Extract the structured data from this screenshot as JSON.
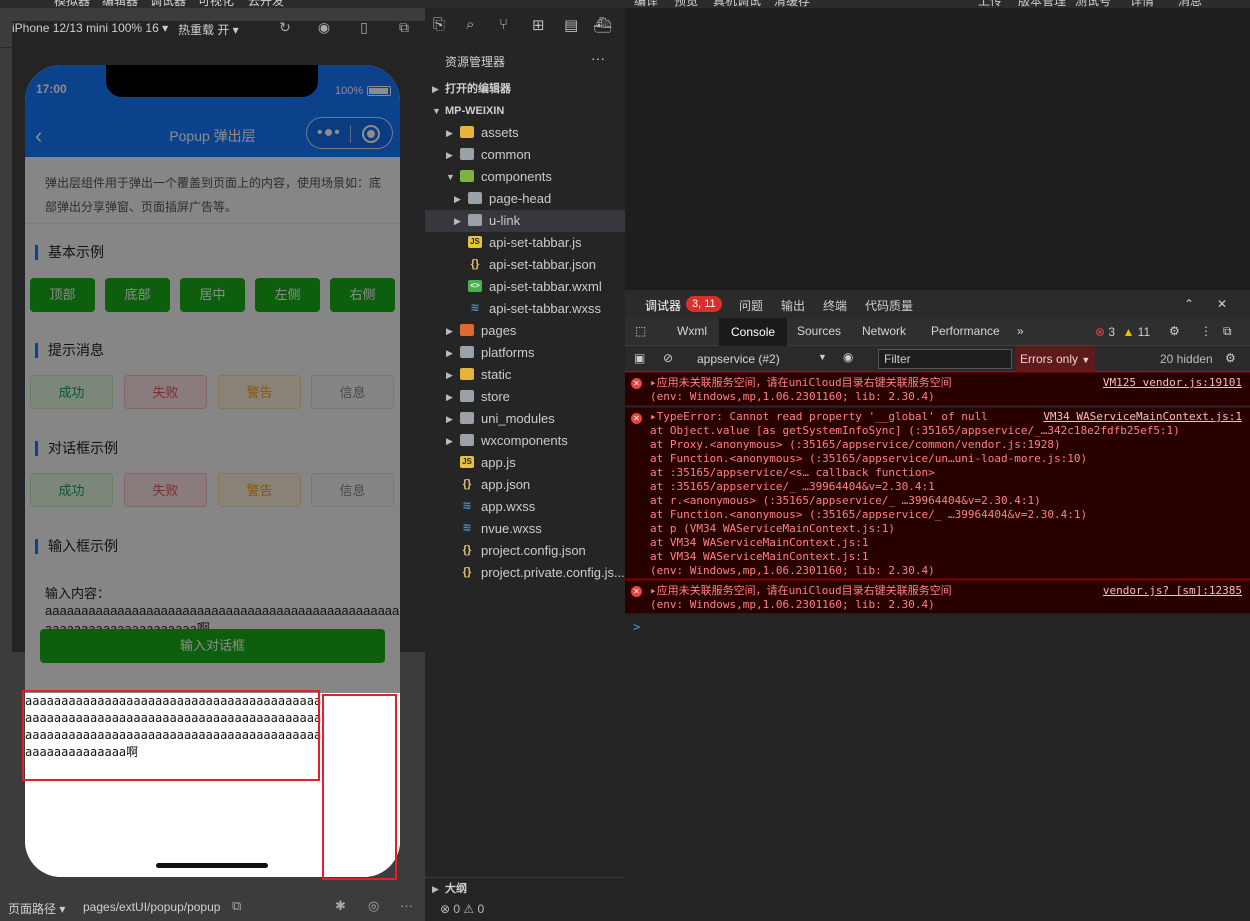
{
  "simulator": {
    "device": "iPhone 12/13 mini 100% 16 ▾",
    "hot_reload": "热重载 开 ▾",
    "status_time": "17:00",
    "battery": "100%",
    "nav_title": "Popup 弹出层",
    "intro": "弹出层组件用于弹出一个覆盖到页面上的内容，使用场景如：底部弹出分享弹窗、页面插屏广告等。",
    "sections": {
      "basic": "基本示例",
      "message": "提示消息",
      "dialog": "对话框示例",
      "input": "输入框示例"
    },
    "basic_buttons": [
      "顶部",
      "底部",
      "居中",
      "左侧",
      "右侧"
    ],
    "message_buttons": [
      "成功",
      "失败",
      "警告",
      "信息"
    ],
    "dialog_buttons": [
      "成功",
      "失败",
      "警告",
      "信息"
    ],
    "input_label": "输入内容：",
    "input_value": "aaaaaaaaaaaaaaaaaaaaaaaaaaaaaaaaaaaaaaaaaaaaaaaaaaaaaaaaaaaaaaaaaaaaaa啊",
    "input_button": "输入对话框",
    "popup_text": "aaaaaaaaaaaaaaaaaaaaaaaaaaaaaaaaaaaaaaaaaaaaaaaaaaaaaaaaaaaaaaaaaaaaaaaaaaaaaaaaaaaaaaaaaaaaaaaaaaaaaaaaaaaaaaaaaaaaaaaaaaaaaaaaaaaaaaaaa啊",
    "bottom_path_label": "页面路径 ▾",
    "bottom_path": "pages/extUI/popup/popup"
  },
  "top_menu": [
    "模拟器",
    "编辑器",
    "调试器",
    "可视化",
    "云开发",
    "编译",
    "预览",
    "真机调试",
    "清缓存",
    "上传",
    "版本管理",
    "测试号",
    "详情",
    "消息"
  ],
  "explorer": {
    "title": "资源管理器",
    "more": "···",
    "open_editors": "打开的编辑器",
    "project": "MP-WEIXIN",
    "items": [
      {
        "label": "assets",
        "type": "folder-y",
        "depth": 1
      },
      {
        "label": "common",
        "type": "folder",
        "depth": 1
      },
      {
        "label": "components",
        "type": "folder-g",
        "depth": 1,
        "open": true
      },
      {
        "label": "page-head",
        "type": "folder",
        "depth": 2
      },
      {
        "label": "u-link",
        "type": "folder",
        "depth": 2,
        "selected": true
      },
      {
        "label": "api-set-tabbar.js",
        "type": "js",
        "depth": 2
      },
      {
        "label": "api-set-tabbar.json",
        "type": "json",
        "depth": 2
      },
      {
        "label": "api-set-tabbar.wxml",
        "type": "wxml",
        "depth": 2
      },
      {
        "label": "api-set-tabbar.wxss",
        "type": "wxss",
        "depth": 2
      },
      {
        "label": "pages",
        "type": "folder-o",
        "depth": 1
      },
      {
        "label": "platforms",
        "type": "folder",
        "depth": 1
      },
      {
        "label": "static",
        "type": "folder-y",
        "depth": 1
      },
      {
        "label": "store",
        "type": "folder",
        "depth": 1
      },
      {
        "label": "uni_modules",
        "type": "folder",
        "depth": 1
      },
      {
        "label": "wxcomponents",
        "type": "folder",
        "depth": 1
      },
      {
        "label": "app.js",
        "type": "js",
        "depth": 1
      },
      {
        "label": "app.json",
        "type": "json",
        "depth": 1
      },
      {
        "label": "app.wxss",
        "type": "wxss",
        "depth": 1
      },
      {
        "label": "nvue.wxss",
        "type": "wxss",
        "depth": 1
      },
      {
        "label": "project.config.json",
        "type": "json",
        "depth": 1
      },
      {
        "label": "project.private.config.js...",
        "type": "json",
        "depth": 1
      }
    ],
    "outline": "大纲",
    "status": "⊗ 0 ⚠ 0"
  },
  "devtools": {
    "tabs_top": [
      "调试器",
      "问题",
      "输出",
      "终端",
      "代码质量"
    ],
    "badge": "3, 11",
    "panel_tabs": [
      "Wxml",
      "Console",
      "Sources",
      "Network",
      "Performance"
    ],
    "active_tab": "Console",
    "error_count": "3",
    "warn_count": "11",
    "context": "appservice (#2)",
    "filter_placeholder": "Filter",
    "level": "Errors only",
    "hidden": "20 hidden",
    "entries": [
      {
        "lines": [
          "▸应用未关联服务空间，请在uniCloud目录右键关联服务空间",
          "(env: Windows,mp,1.06.2301160; lib: 2.30.4)"
        ],
        "source": "VM125 vendor.js:19101"
      },
      {
        "lines": [
          "▸TypeError: Cannot read property '__global' of null",
          "    at Object.value [as getSystemInfoSync] (:35165/appservice/_…342c18e2fdfb25ef5:1)",
          "    at Proxy.<anonymous> (:35165/appservice/common/vendor.js:1928)",
          "    at Function.<anonymous> (:35165/appservice/un…uni-load-more.js:10)",
          "    at :35165/appservice/<s… callback function>",
          "    at :35165/appservice/_ …39964404&v=2.30.4:1",
          "    at r.<anonymous> (:35165/appservice/_ …39964404&v=2.30.4:1)",
          "    at Function.<anonymous> (:35165/appservice/_ …39964404&v=2.30.4:1)",
          "    at p (VM34 WAServiceMainContext.js:1)",
          "    at VM34 WAServiceMainContext.js:1",
          "    at VM34 WAServiceMainContext.js:1",
          "(env: Windows,mp,1.06.2301160; lib: 2.30.4)"
        ],
        "source": "VM34 WAServiceMainContext.js:1"
      },
      {
        "lines": [
          "▸应用未关联服务空间，请在uniCloud目录右键关联服务空间",
          "(env: Windows,mp,1.06.2301160; lib: 2.30.4)"
        ],
        "source": "vendor.js? [sm]:12385"
      }
    ],
    "prompt": ">"
  },
  "colors": {
    "nav_blue": "#1677ff",
    "button_green": "#1aad19",
    "error_bg": "#290000",
    "error_text": "#ff8080",
    "highlight_red": "#e0202a"
  }
}
